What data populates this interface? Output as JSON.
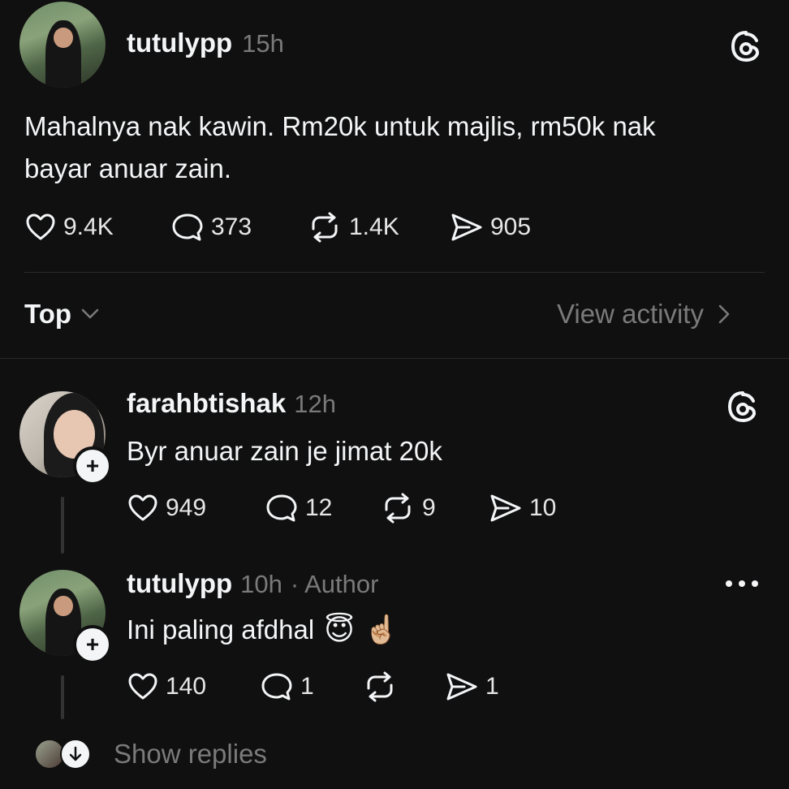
{
  "post": {
    "username": "tutulypp",
    "time": "15h",
    "text_line1": "Mahalnya nak kawin. Rm20k untuk majlis, rm50k nak",
    "text_line2": "bayar anuar zain.",
    "likes": "9.4K",
    "comments": "373",
    "reposts": "1.4K",
    "shares": "905"
  },
  "sort": {
    "label": "Top",
    "view_activity": "View activity"
  },
  "replies": [
    {
      "username": "farahbtishak",
      "time": "12h",
      "text": "Byr anuar zain je jimat 20k",
      "likes": "949",
      "comments": "12",
      "reposts": "9",
      "shares": "10"
    },
    {
      "username": "tutulypp",
      "time": "10h",
      "author_tag": "· Author",
      "text": "Ini paling afdhal",
      "emoji1": "😇",
      "emoji2": "☝🏼",
      "likes": "140",
      "comments": "1",
      "reposts": "",
      "shares": "1"
    }
  ],
  "show_replies": "Show replies",
  "icons": {
    "threads": "threads-logo-icon",
    "like": "heart-icon",
    "comment": "comment-bubble-icon",
    "repost": "repost-icon",
    "share": "send-icon",
    "more": "more-dots-icon",
    "chevron_down": "chevron-down-icon",
    "chevron_right": "chevron-right-icon"
  },
  "colors": {
    "background": "#101010",
    "text": "#f3f5f7",
    "muted": "#7a7a7a"
  }
}
